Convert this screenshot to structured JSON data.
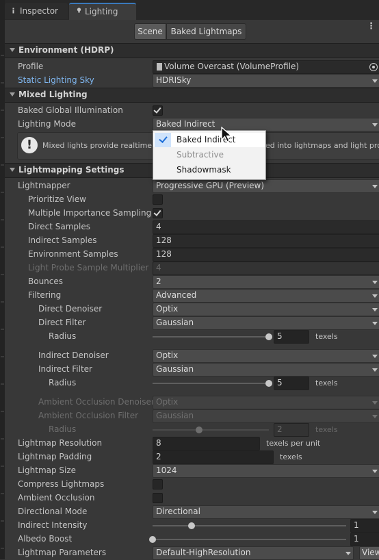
{
  "tabs": {
    "inspector": "Inspector",
    "lighting": "Lighting"
  },
  "toolbar": {
    "scene": "Scene",
    "baked": "Baked Lightmaps"
  },
  "sections": {
    "environment": "Environment (HDRP)",
    "mixed": "Mixed Lighting",
    "lightmapping": "Lightmapping Settings"
  },
  "environment": {
    "profile_label": "Profile",
    "profile_value": "Volume Overcast (VolumeProfile)",
    "sky_label": "Static Lighting Sky",
    "sky_value": "HDRISky"
  },
  "mixed": {
    "bgi_label": "Baked Global Illumination",
    "bgi_checked": true,
    "mode_label": "Lighting Mode",
    "mode_value": "Baked Indirect",
    "info_left": "Mixed lights provide realtime dire",
    "info_right": "ed into lightmaps and light probes."
  },
  "popup": {
    "items": [
      {
        "label": "Baked Indirect",
        "checked": true
      },
      {
        "label": "Subtractive",
        "disabled": true
      },
      {
        "label": "Shadowmask"
      }
    ]
  },
  "lightmapping": {
    "lightmapper": {
      "label": "Lightmapper",
      "value": "Progressive GPU (Preview)"
    },
    "prioritize_view": {
      "label": "Prioritize View",
      "checked": false
    },
    "mis": {
      "label": "Multiple Importance Sampling",
      "checked": true
    },
    "direct_samples": {
      "label": "Direct Samples",
      "value": "4"
    },
    "indirect_samples": {
      "label": "Indirect Samples",
      "value": "128"
    },
    "environment_samples": {
      "label": "Environment Samples",
      "value": "128"
    },
    "light_probe_mult": {
      "label": "Light Probe Sample Multiplier",
      "value": "4"
    },
    "bounces": {
      "label": "Bounces",
      "value": "2"
    },
    "filtering": {
      "label": "Filtering",
      "value": "Advanced"
    },
    "direct_denoiser": {
      "label": "Direct Denoiser",
      "value": "Optix"
    },
    "direct_filter": {
      "label": "Direct Filter",
      "value": "Gaussian"
    },
    "direct_radius": {
      "label": "Radius",
      "value": "5",
      "unit": "texels",
      "fraction": 1.0
    },
    "indirect_denoiser": {
      "label": "Indirect Denoiser",
      "value": "Optix"
    },
    "indirect_filter": {
      "label": "Indirect Filter",
      "value": "Gaussian"
    },
    "indirect_radius": {
      "label": "Radius",
      "value": "5",
      "unit": "texels",
      "fraction": 1.0
    },
    "ao_denoiser": {
      "label": "Ambient Occlusion Denoiser",
      "value": "Optix"
    },
    "ao_filter": {
      "label": "Ambient Occlusion Filter",
      "value": "Gaussian"
    },
    "ao_radius": {
      "label": "Radius",
      "value": "2",
      "unit": "texels",
      "fraction": 0.4
    },
    "resolution": {
      "label": "Lightmap Resolution",
      "value": "8",
      "unit": "texels per unit"
    },
    "padding": {
      "label": "Lightmap Padding",
      "value": "2",
      "unit": "texels"
    },
    "size": {
      "label": "Lightmap Size",
      "value": "1024"
    },
    "compress": {
      "label": "Compress Lightmaps",
      "checked": false
    },
    "ambient_occlusion": {
      "label": "Ambient Occlusion",
      "checked": false
    },
    "directional_mode": {
      "label": "Directional Mode",
      "value": "Directional"
    },
    "indirect_intensity": {
      "label": "Indirect Intensity",
      "value": "1",
      "fraction": 0.2
    },
    "albedo_boost": {
      "label": "Albedo Boost",
      "value": "1",
      "fraction": 0.0
    },
    "parameters": {
      "label": "Lightmap Parameters",
      "value": "Default-HighResolution",
      "view": "View"
    }
  }
}
